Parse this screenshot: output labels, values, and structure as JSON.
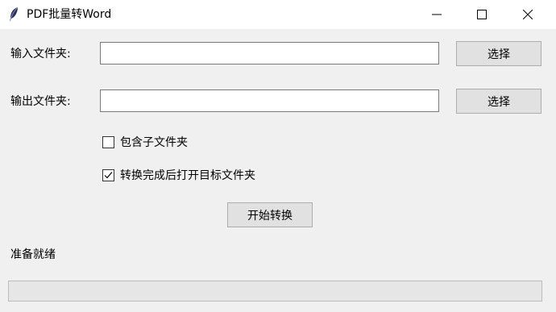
{
  "window": {
    "title": "PDF批量转Word",
    "icon": "feather-icon"
  },
  "form": {
    "input_folder_label": "输入文件夹:",
    "input_folder_value": "",
    "input_choose_label": "选择",
    "output_folder_label": "输出文件夹:",
    "output_folder_value": "",
    "output_choose_label": "选择",
    "include_subfolders_label": "包含子文件夹",
    "include_subfolders_checked": false,
    "open_after_label": "转换完成后打开目标文件夹",
    "open_after_checked": true,
    "start_button_label": "开始转换"
  },
  "status": {
    "text": "准备就绪",
    "progress": 0
  }
}
